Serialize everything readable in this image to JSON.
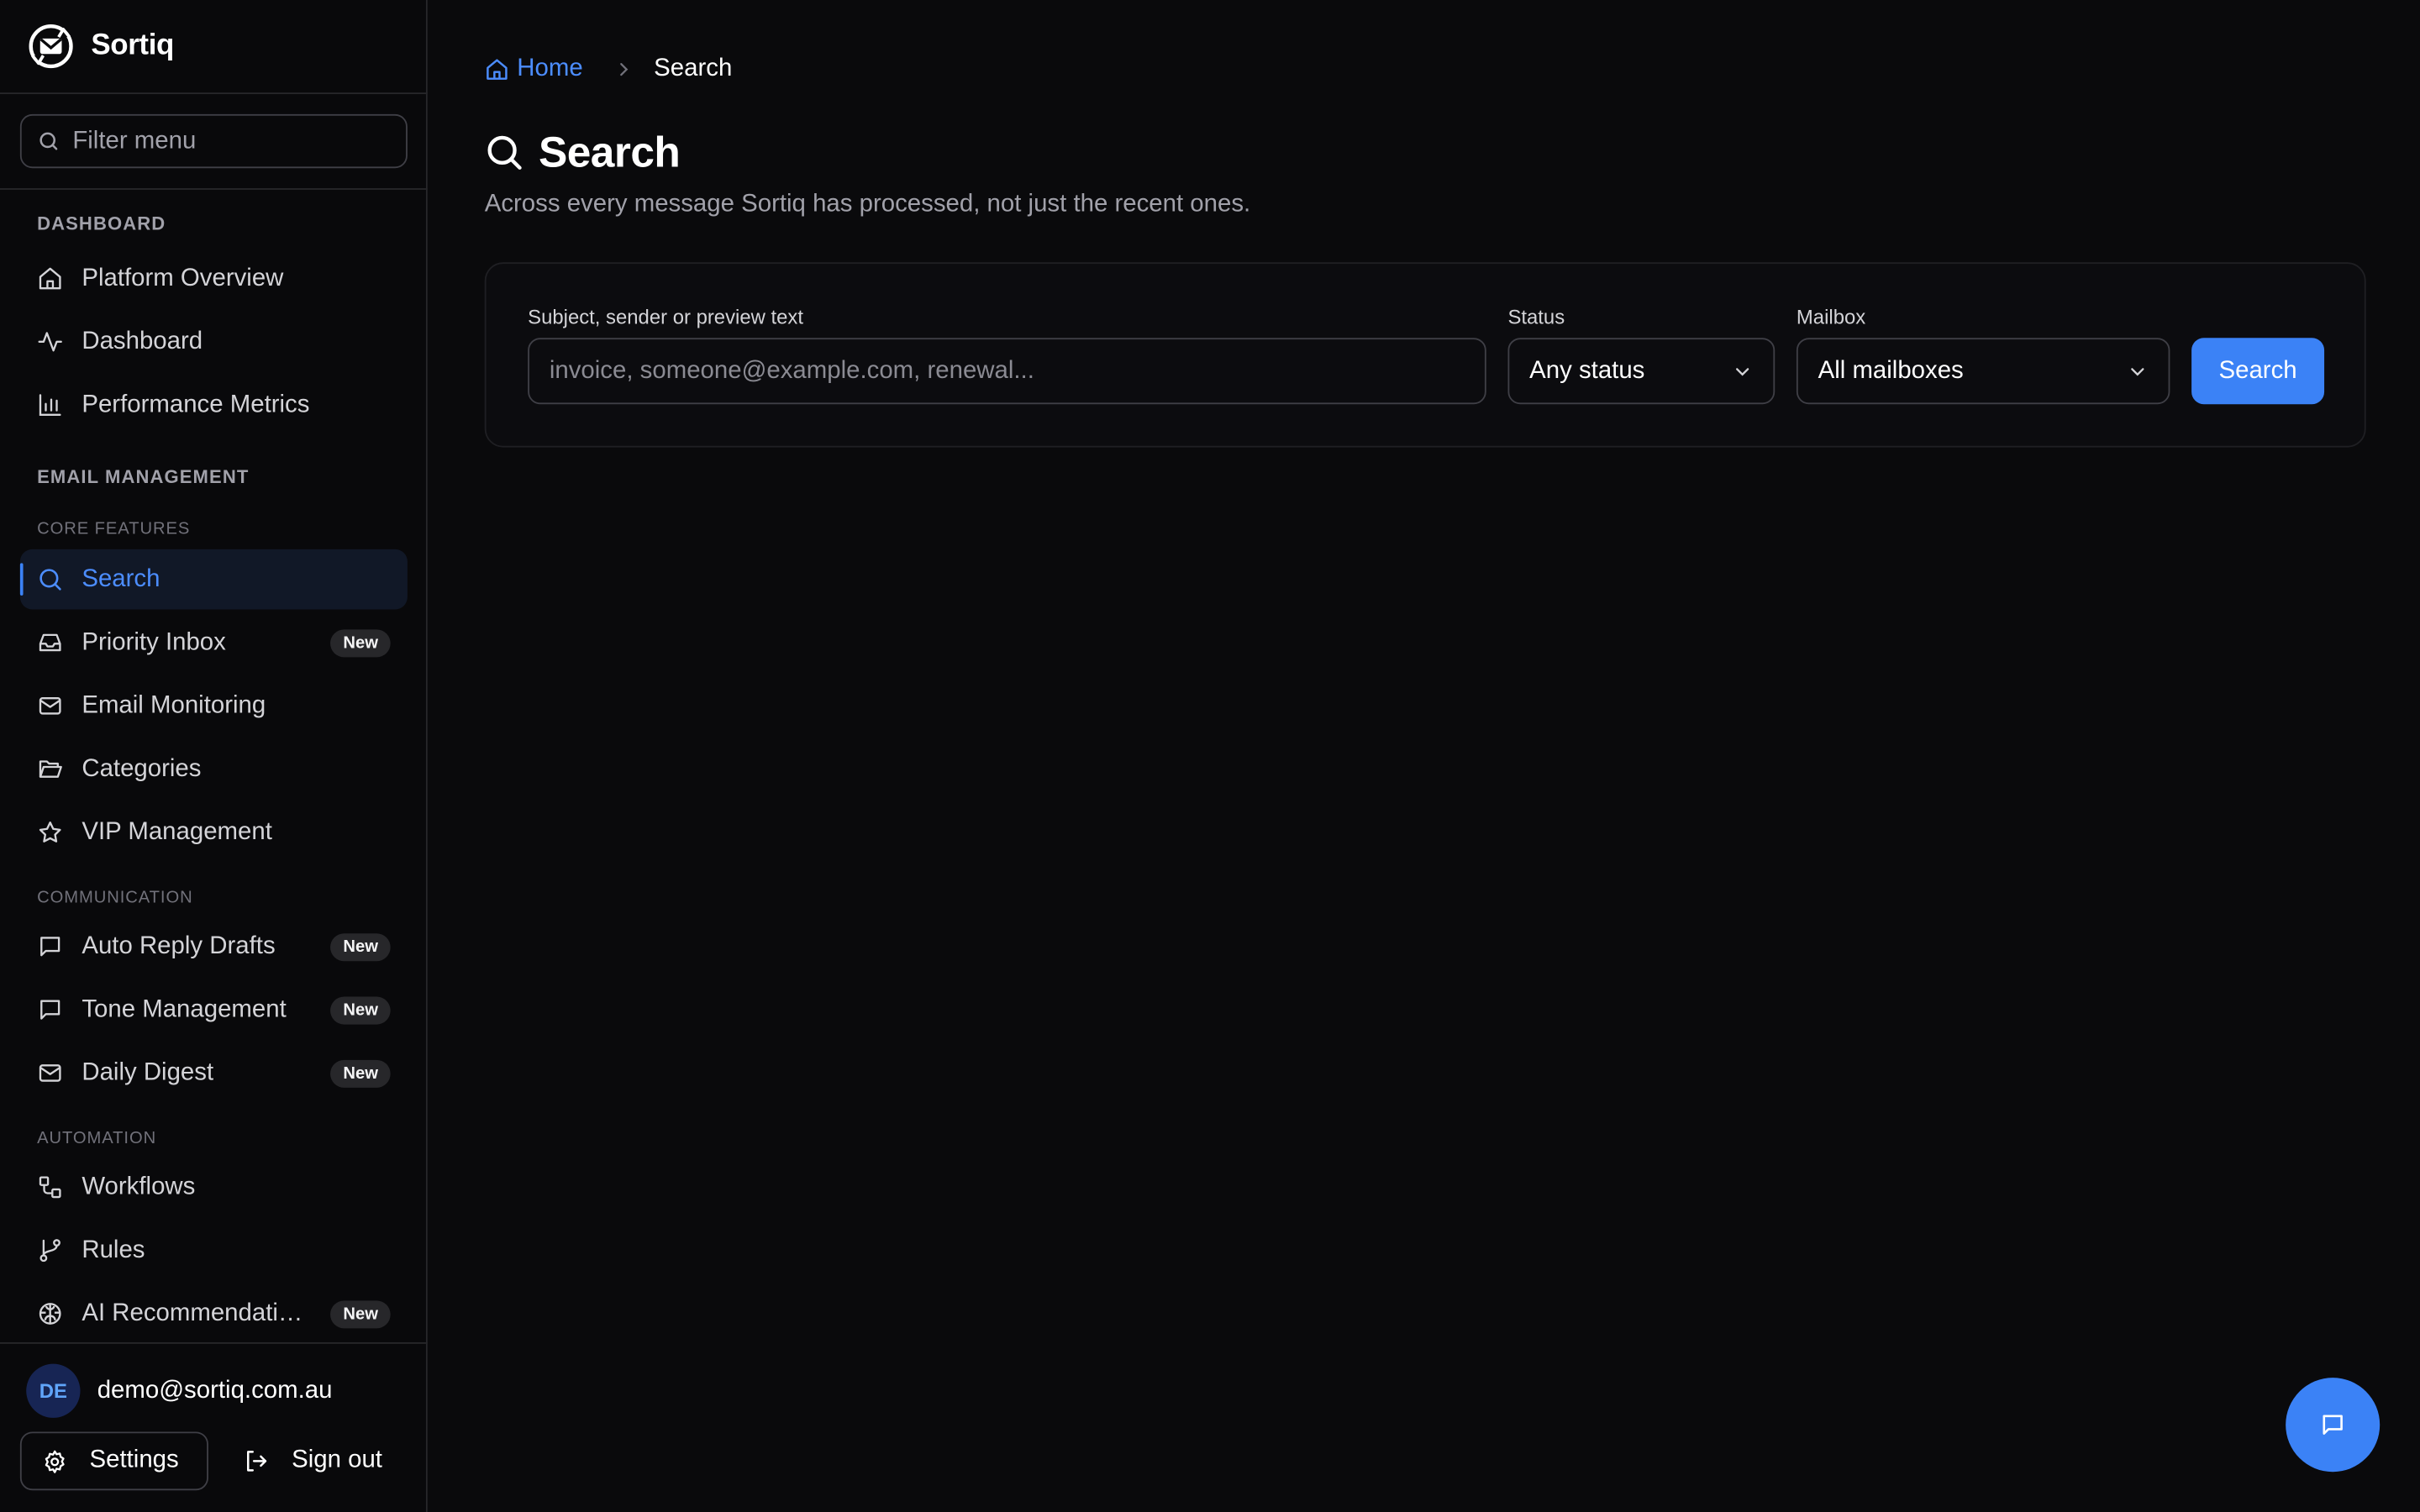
{
  "brand": {
    "name": "Sortiq"
  },
  "sidebar": {
    "filter_placeholder": "Filter menu",
    "sections": {
      "dashboard": "DASHBOARD",
      "email_management": "EMAIL MANAGEMENT",
      "core_features": "CORE FEATURES",
      "communication": "COMMUNICATION",
      "automation": "AUTOMATION"
    },
    "items": [
      {
        "label": "Platform Overview",
        "icon": "home-icon"
      },
      {
        "label": "Dashboard",
        "icon": "activity-icon"
      },
      {
        "label": "Performance Metrics",
        "icon": "bar-chart-icon"
      },
      {
        "label": "Search",
        "icon": "search-icon",
        "active": true
      },
      {
        "label": "Priority Inbox",
        "icon": "inbox-icon",
        "badge": "New"
      },
      {
        "label": "Email Monitoring",
        "icon": "mail-icon"
      },
      {
        "label": "Categories",
        "icon": "folder-open-icon"
      },
      {
        "label": "VIP Management",
        "icon": "star-icon"
      },
      {
        "label": "Auto Reply Drafts",
        "icon": "message-square-icon",
        "badge": "New"
      },
      {
        "label": "Tone Management",
        "icon": "message-square-icon",
        "badge": "New"
      },
      {
        "label": "Daily Digest",
        "icon": "mail-icon",
        "badge": "New"
      },
      {
        "label": "Workflows",
        "icon": "workflow-icon"
      },
      {
        "label": "Rules",
        "icon": "git-branch-icon"
      },
      {
        "label": "AI Recommendatio...",
        "icon": "brain-icon",
        "badge": "New"
      }
    ],
    "user": {
      "initials": "DE",
      "email": "demo@sortiq.com.au"
    },
    "settings_label": "Settings",
    "signout_label": "Sign out"
  },
  "breadcrumb": {
    "home": "Home",
    "current": "Search"
  },
  "page": {
    "title": "Search",
    "subtitle": "Across every message Sortiq has processed, not just the recent ones."
  },
  "search_form": {
    "query_label": "Subject, sender or preview text",
    "query_placeholder": "invoice, someone@example.com, renewal...",
    "query_value": "",
    "status_label": "Status",
    "status_value": "Any status",
    "mailbox_label": "Mailbox",
    "mailbox_value": "All mailboxes",
    "submit_label": "Search"
  },
  "colors": {
    "accent": "#3b82f6",
    "background": "#0a0a0c",
    "border": "#27272a"
  }
}
